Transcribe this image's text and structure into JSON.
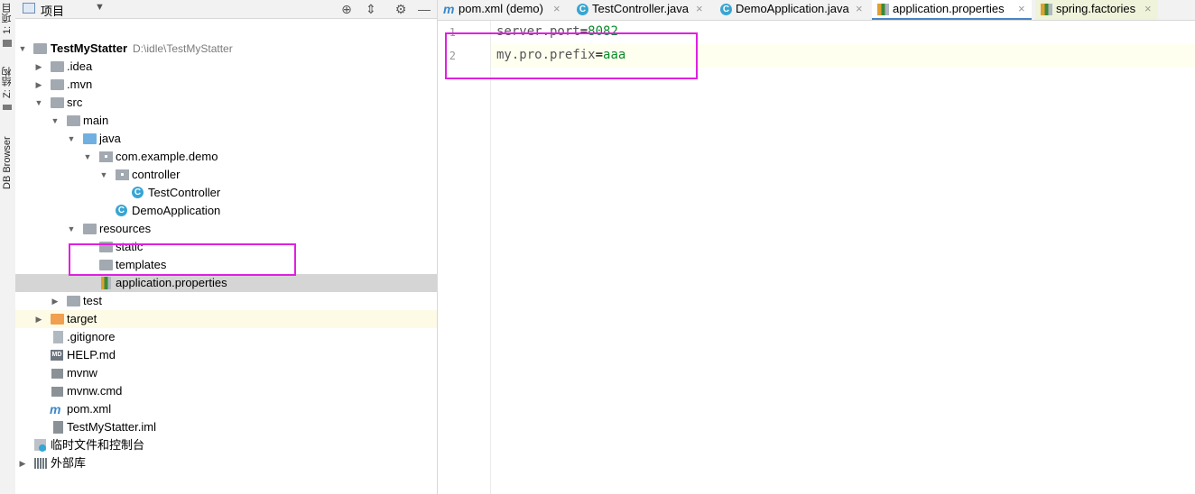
{
  "left_stripe": {
    "project_tab": "1: 项目",
    "structure_tab": "Z: 结构",
    "db_browser_tab": "DB Browser"
  },
  "project_panel": {
    "title": "项目",
    "dropdown_icon": "dropdown-icon",
    "actions": [
      "locate-icon",
      "collapse-icon",
      "gear-icon",
      "minimize-icon"
    ]
  },
  "tree": [
    {
      "label": "TestMyStatter",
      "path": "D:\\idle\\TestMyStatter",
      "icon": "module-folder-icon",
      "arrow": "down"
    },
    {
      "label": ".idea",
      "icon": "folder-icon",
      "arrow": "right"
    },
    {
      "label": ".mvn",
      "icon": "folder-icon",
      "arrow": "right"
    },
    {
      "label": "src",
      "icon": "folder-icon",
      "arrow": "down"
    },
    {
      "label": "main",
      "icon": "folder-icon",
      "arrow": "down"
    },
    {
      "label": "java",
      "icon": "source-folder-icon",
      "arrow": "down"
    },
    {
      "label": "com.example.demo",
      "icon": "package-icon",
      "arrow": "down"
    },
    {
      "label": "controller",
      "icon": "package-icon",
      "arrow": "down"
    },
    {
      "label": "TestController",
      "icon": "class-icon",
      "arrow": ""
    },
    {
      "label": "DemoApplication",
      "icon": "spring-class-icon",
      "arrow": ""
    },
    {
      "label": "resources",
      "icon": "resources-folder-icon",
      "arrow": "down"
    },
    {
      "label": "static",
      "icon": "folder-icon",
      "arrow": ""
    },
    {
      "label": "templates",
      "icon": "folder-icon",
      "arrow": ""
    },
    {
      "label": "application.properties",
      "icon": "properties-file-icon",
      "arrow": ""
    },
    {
      "label": "test",
      "icon": "folder-icon",
      "arrow": "right"
    },
    {
      "label": "target",
      "icon": "excluded-folder-icon",
      "arrow": "right"
    },
    {
      "label": ".gitignore",
      "icon": "text-file-icon",
      "arrow": ""
    },
    {
      "label": "HELP.md",
      "icon": "markdown-file-icon",
      "arrow": ""
    },
    {
      "label": "mvnw",
      "icon": "script-file-icon",
      "arrow": ""
    },
    {
      "label": "mvnw.cmd",
      "icon": "script-file-icon",
      "arrow": ""
    },
    {
      "label": "pom.xml",
      "icon": "maven-file-icon",
      "arrow": ""
    },
    {
      "label": "TestMyStatter.iml",
      "icon": "iml-file-icon",
      "arrow": ""
    },
    {
      "label": "临时文件和控制台",
      "icon": "scratches-icon",
      "arrow": ""
    },
    {
      "label": "外部库",
      "icon": "libraries-icon",
      "arrow": "right"
    }
  ],
  "tabs": [
    {
      "label": "pom.xml (demo)",
      "icon": "maven-file-icon"
    },
    {
      "label": "TestController.java",
      "icon": "class-icon"
    },
    {
      "label": "DemoApplication.java",
      "icon": "spring-class-icon"
    },
    {
      "label": "application.properties",
      "icon": "properties-file-icon"
    },
    {
      "label": "spring.factories",
      "icon": "properties-file-icon"
    }
  ],
  "close_glyph": "×",
  "editor": {
    "line_numbers": [
      "1",
      "2"
    ],
    "lines": [
      {
        "key": "server.port",
        "eq": "=",
        "value": "8082"
      },
      {
        "key": "my.pro.prefix",
        "eq": "=",
        "value": "aaa"
      }
    ]
  },
  "colors": {
    "highlight_box": "#e020e0",
    "selected_row": "#d5d5d5",
    "property_value": "#098b2a",
    "active_tab_underline": "#4a84c4"
  }
}
